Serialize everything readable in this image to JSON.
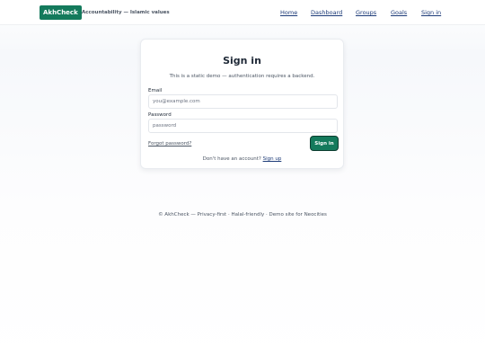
{
  "header": {
    "logo": "AkhCheck",
    "tagline": "Accountability — Islamic values",
    "nav": {
      "home": "Home",
      "dashboard": "Dashboard",
      "groups": "Groups",
      "goals": "Goals",
      "signin": "Sign in"
    }
  },
  "card": {
    "title": "Sign in",
    "subtitle": "This is a static demo — authentication requires a backend.",
    "email_label": "Email",
    "email_placeholder": "you@example.com",
    "password_label": "Password",
    "password_placeholder": "password",
    "forgot_link": "Forgot password?",
    "submit_label": "Sign in",
    "no_account_text": "Don't have an account?",
    "signup_link": "Sign up"
  },
  "footer": {
    "text": "© AkhCheck — Privacy-first · Halal-friendly · Demo site for Neocities"
  },
  "colors": {
    "brand": "#147a5c",
    "link": "#1d3b78"
  }
}
